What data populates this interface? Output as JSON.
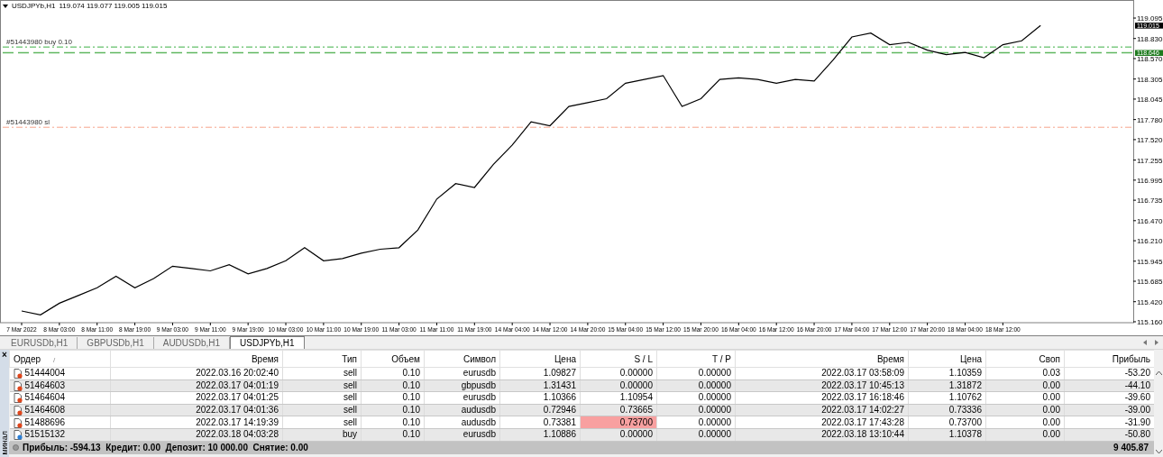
{
  "chart": {
    "ohlc": "119.074 119.077 119.005 119.015",
    "chart_data": {
      "type": "line",
      "series": [
        {
          "name": "USDJPYb,H1",
          "color": "#000000",
          "values": [
            115.3,
            115.25,
            115.4,
            115.5,
            115.6,
            115.75,
            115.6,
            115.72,
            115.88,
            115.85,
            115.82,
            115.9,
            115.78,
            115.85,
            115.95,
            116.12,
            115.95,
            115.98,
            116.05,
            116.1,
            116.12,
            116.35,
            116.75,
            116.95,
            116.9,
            117.2,
            117.45,
            117.75,
            117.7,
            117.95,
            118.0,
            118.05,
            118.25,
            118.3,
            118.35,
            117.95,
            118.05,
            118.3,
            118.32,
            118.3,
            118.25,
            118.3,
            118.28,
            118.55,
            118.85,
            118.9,
            118.75,
            118.78,
            118.68,
            118.62,
            118.65,
            118.58,
            118.75,
            118.8,
            119.0
          ]
        }
      ],
      "categories": [
        "7 Mar 2022",
        null,
        "8 Mar 03:00",
        null,
        "8 Mar 11:00",
        null,
        "8 Mar 19:00",
        null,
        "9 Mar 03:00",
        null,
        "9 Mar 11:00",
        null,
        "9 Mar 19:00",
        null,
        "10 Mar 03:00",
        null,
        "10 Mar 11:00",
        null,
        "10 Mar 19:00",
        null,
        "11 Mar 03:00",
        null,
        "11 Mar 11:00",
        null,
        "11 Mar 19:00",
        null,
        "14 Mar 04:00",
        null,
        "14 Mar 12:00",
        null,
        "14 Mar 20:00",
        null,
        "15 Mar 04:00",
        null,
        "15 Mar 12:00",
        null,
        "15 Mar 20:00",
        null,
        "16 Mar 04:00",
        null,
        "16 Mar 12:00",
        null,
        "16 Mar 20:00",
        null,
        "17 Mar 04:00",
        null,
        "17 Mar 12:00",
        null,
        "17 Mar 20:00",
        null,
        "18 Mar 04:00",
        null,
        "18 Mar 12:00",
        null,
        null
      ],
      "ylim": [
        115.148,
        119.329
      ],
      "yticks": [
        {
          "value": 119.095,
          "label": "119.095"
        },
        {
          "value": 118.83,
          "label": "118.830"
        },
        {
          "value": 118.57,
          "label": "118.570"
        },
        {
          "value": 118.305,
          "label": "118.305"
        },
        {
          "value": 118.045,
          "label": "118.045"
        },
        {
          "value": 117.78,
          "label": "117.780"
        },
        {
          "value": 117.52,
          "label": "117.520"
        },
        {
          "value": 117.255,
          "label": "117.255"
        },
        {
          "value": 116.995,
          "label": "116.995"
        },
        {
          "value": 116.735,
          "label": "116.735"
        },
        {
          "value": 116.47,
          "label": "116.470"
        },
        {
          "value": 116.21,
          "label": "116.210"
        },
        {
          "value": 115.945,
          "label": "115.945"
        },
        {
          "value": 115.685,
          "label": "115.685"
        },
        {
          "value": 115.42,
          "label": "115.420"
        },
        {
          "value": 115.16,
          "label": "115.160"
        }
      ],
      "ref_lines": [
        {
          "axis": "y",
          "value": 118.72,
          "label": "#51443980 buy 0.10",
          "color": "#3cb043"
        },
        {
          "axis": "y",
          "value": 118.646,
          "label": "118.646",
          "color": "#5fb760"
        },
        {
          "axis": "y",
          "value": 117.68,
          "label": "#51443980 sl",
          "color": "#f7a48c"
        }
      ],
      "annotations": [
        "119.015"
      ]
    }
  },
  "tabs": [
    {
      "label": "EURUSDb,H1",
      "selected": false
    },
    {
      "label": "GBPUSDb,H1",
      "selected": false
    },
    {
      "label": "AUDUSDb,H1",
      "selected": false
    },
    {
      "label": "USDJPYb,H1",
      "selected": true
    }
  ],
  "terminal": {
    "close": "×",
    "label": "минал"
  },
  "table": {
    "sort_mark": "/",
    "columns": [
      "Ордер",
      "Время",
      "Тип",
      "Объем",
      "Символ",
      "Цена",
      "S / L",
      "T / P",
      "Время",
      "Цена",
      "Своп",
      "Прибыль"
    ],
    "rows": [
      {
        "kind": "sell",
        "sl_highlight": false,
        "cells": [
          "51444004",
          "2022.03.16 20:02:40",
          "sell",
          "0.10",
          "eurusdb",
          "1.09827",
          "0.00000",
          "0.00000",
          "2022.03.17 03:58:09",
          "1.10359",
          "0.03",
          "-53.20"
        ]
      },
      {
        "kind": "sell",
        "sl_highlight": false,
        "cells": [
          "51464603",
          "2022.03.17 04:01:19",
          "sell",
          "0.10",
          "gbpusdb",
          "1.31431",
          "0.00000",
          "0.00000",
          "2022.03.17 10:45:13",
          "1.31872",
          "0.00",
          "-44.10"
        ]
      },
      {
        "kind": "sell",
        "sl_highlight": false,
        "cells": [
          "51464604",
          "2022.03.17 04:01:25",
          "sell",
          "0.10",
          "eurusdb",
          "1.10366",
          "1.10954",
          "0.00000",
          "2022.03.17 16:18:46",
          "1.10762",
          "0.00",
          "-39.60"
        ]
      },
      {
        "kind": "sell",
        "sl_highlight": false,
        "cells": [
          "51464608",
          "2022.03.17 04:01:36",
          "sell",
          "0.10",
          "audusdb",
          "0.72946",
          "0.73665",
          "0.00000",
          "2022.03.17 14:02:27",
          "0.73336",
          "0.00",
          "-39.00"
        ]
      },
      {
        "kind": "sell",
        "sl_highlight": true,
        "cells": [
          "51488696",
          "2022.03.17 14:19:39",
          "sell",
          "0.10",
          "audusdb",
          "0.73381",
          "0.73700",
          "0.00000",
          "2022.03.17 17:43:28",
          "0.73700",
          "0.00",
          "-31.90"
        ]
      },
      {
        "kind": "buy",
        "sl_highlight": false,
        "cells": [
          "51515132",
          "2022.03.18 04:03:28",
          "buy",
          "0.10",
          "eurusdb",
          "1.10886",
          "0.00000",
          "0.00000",
          "2022.03.18 13:10:44",
          "1.10378",
          "0.00",
          "-50.80"
        ]
      }
    ],
    "summary": "Прибыль: -594.13  Кредит: 0.00  Депозит: 10 000.00  Снятие: 0.00",
    "balance": "9 405.87"
  }
}
